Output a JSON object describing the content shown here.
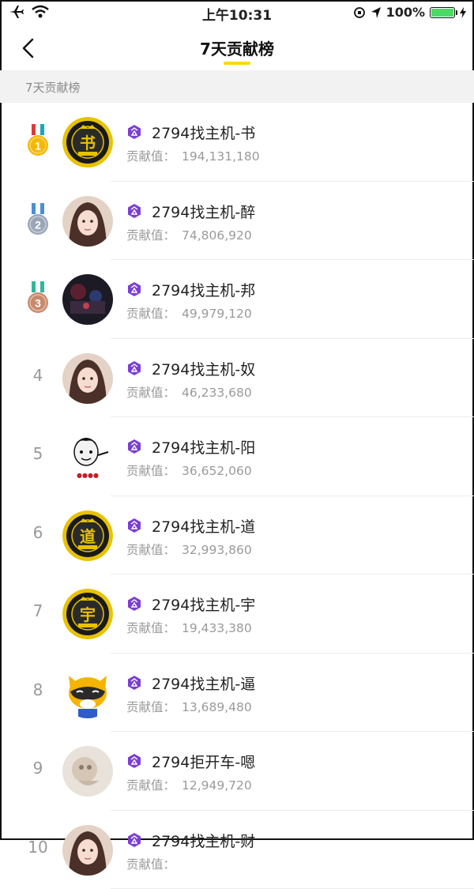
{
  "status_bar": {
    "time": "上午10:31",
    "battery": "100%"
  },
  "nav": {
    "title": "7天贡献榜"
  },
  "section": {
    "label": "7天贡献榜"
  },
  "contrib_label": "贡献值：",
  "colors": {
    "accent": "#ffd800",
    "badge": "#7b3fd1",
    "gold": "#f5b800",
    "silver": "#9aa6b8",
    "bronze": "#c9896b"
  },
  "rows": [
    {
      "rank": "1",
      "name": "2794找主机-书",
      "value": "194,131,180",
      "avatar": "gold-seal",
      "char": "书"
    },
    {
      "rank": "2",
      "name": "2794找主机-醉",
      "value": "74,806,920",
      "avatar": "photo"
    },
    {
      "rank": "3",
      "name": "2794找主机-邦",
      "value": "49,979,120",
      "avatar": "dark-photo"
    },
    {
      "rank": "4",
      "name": "2794找主机-奴",
      "value": "46,233,680",
      "avatar": "photo"
    },
    {
      "rank": "5",
      "name": "2794找主机-阳",
      "value": "36,652,060",
      "avatar": "cartoon"
    },
    {
      "rank": "6",
      "name": "2794找主机-道",
      "value": "32,993,860",
      "avatar": "gold-seal",
      "char": "道"
    },
    {
      "rank": "7",
      "name": "2794找主机-宇",
      "value": "19,433,380",
      "avatar": "gold-seal",
      "char": "宇"
    },
    {
      "rank": "8",
      "name": "2794找主机-逼",
      "value": "13,689,480",
      "avatar": "raccoon"
    },
    {
      "rank": "9",
      "name": "2794拒开车-嗯",
      "value": "12,949,720",
      "avatar": "pale-photo"
    },
    {
      "rank": "10",
      "name": "2794找主机-财",
      "value": "",
      "avatar": "photo"
    }
  ]
}
